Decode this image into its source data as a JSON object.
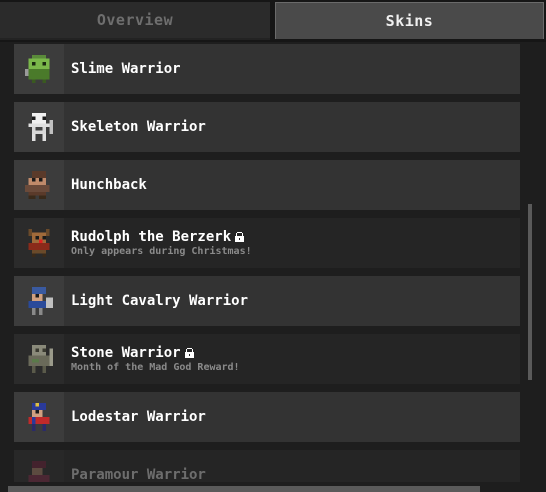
{
  "tabs": {
    "overview": "Overview",
    "skins": "Skins"
  },
  "skins": [
    {
      "name": "Slime Warrior",
      "subtitle": "",
      "locked": false,
      "icon": "slime-warrior-sprite"
    },
    {
      "name": "Skeleton Warrior",
      "subtitle": "",
      "locked": false,
      "icon": "skeleton-warrior-sprite"
    },
    {
      "name": "Hunchback",
      "subtitle": "",
      "locked": false,
      "icon": "hunchback-sprite"
    },
    {
      "name": "Rudolph the Berzerk",
      "subtitle": "Only appears during Christmas!",
      "locked": true,
      "icon": "rudolph-sprite"
    },
    {
      "name": "Light Cavalry Warrior",
      "subtitle": "",
      "locked": false,
      "icon": "light-cavalry-sprite"
    },
    {
      "name": "Stone Warrior",
      "subtitle": "Month of the Mad God Reward!",
      "locked": true,
      "icon": "stone-warrior-sprite"
    },
    {
      "name": "Lodestar Warrior",
      "subtitle": "",
      "locked": false,
      "icon": "lodestar-warrior-sprite"
    },
    {
      "name": "Paramour Warrior",
      "subtitle": "",
      "locked": false,
      "icon": "paramour-warrior-sprite"
    }
  ],
  "colors": {
    "row_available": "#333333",
    "row_locked": "#252525",
    "tab_active": "#4a4a4a",
    "tab_inactive": "#2b2b2b"
  }
}
